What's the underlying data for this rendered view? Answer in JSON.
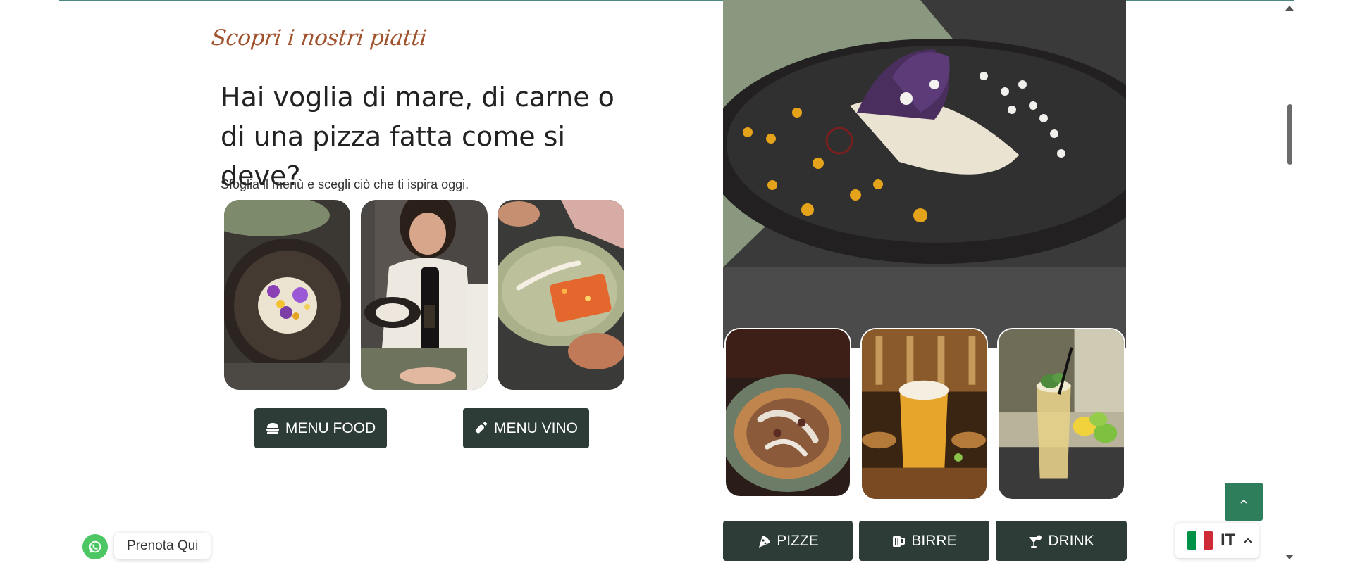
{
  "intro": {
    "script_title": "Scopri i nostri piatti",
    "headline": "Hai voglia di mare, di carne o di una pizza fatta come si deve?",
    "subtext": "Sfoglia il menù e scegli ciò che ti ispira oggi."
  },
  "menu_buttons": {
    "food_label": "MENU FOOD",
    "food_icon": "burger-icon",
    "wine_label": "MENU VINO",
    "wine_icon": "wine-bottle-icon"
  },
  "category_buttons": [
    {
      "label": "PIZZE",
      "icon": "pizza-slice-icon"
    },
    {
      "label": "BIRRE",
      "icon": "beer-mug-icon"
    },
    {
      "label": "DRINK",
      "icon": "cocktail-icon"
    }
  ],
  "whatsapp": {
    "label": "Prenota Qui",
    "icon": "whatsapp-icon"
  },
  "language": {
    "code": "IT",
    "flag_colors": [
      "#009246",
      "#ffffff",
      "#ce2b37"
    ]
  },
  "images": {
    "left": [
      "plated-dish-photo",
      "woman-with-wine-bottle-photo",
      "served-plate-photo"
    ],
    "main": "gourmet-dish-photo",
    "right": [
      "pizza-photo",
      "beer-photo",
      "cocktail-photo"
    ]
  },
  "colors": {
    "button_bg": "#2d3c36",
    "script_accent": "#a0522d",
    "back_to_top": "#2e7d5b",
    "whatsapp_green": "#4cc764"
  }
}
